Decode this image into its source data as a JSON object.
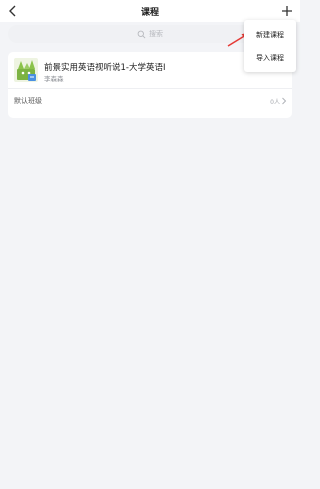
{
  "header": {
    "title": "课程",
    "back_icon": "chevron-left-icon",
    "add_icon": "plus-icon"
  },
  "search": {
    "placeholder": "搜索",
    "icon": "search-icon"
  },
  "course": {
    "name": "前景实用英语视听说1-大学英语I",
    "teacher": "李森森",
    "class_name": "默认班级",
    "class_count": "0人"
  },
  "menu": {
    "items": [
      {
        "label": "新建课程"
      },
      {
        "label": "导入课程"
      }
    ]
  },
  "colors": {
    "background": "#f3f4f7",
    "card": "#ffffff",
    "annotation_arrow": "#e53935",
    "thumb_green": "#7cb342"
  }
}
